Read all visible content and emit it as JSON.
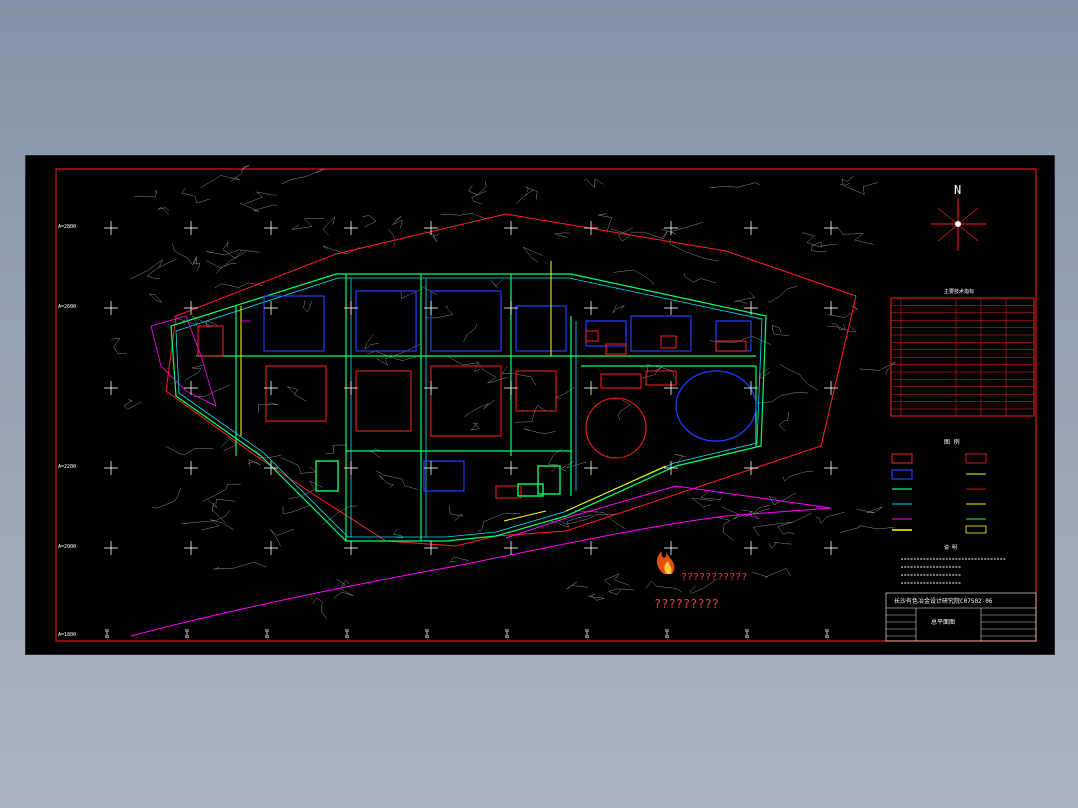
{
  "drawing": {
    "north_label": "N",
    "watermark_line1": "???????????",
    "watermark_line2": "?????????",
    "title_block_heading": "长沙有色冶金设计研究院C07502-06",
    "title_block_name": "总平面图",
    "legend_title": "图 例",
    "notes_title": "说 明",
    "table_title": "主要技术指标"
  },
  "colors": {
    "background": "#000000",
    "border": "#ff2020",
    "terrain": "#c8c8c8",
    "road": "#00ff66",
    "building_blue": "#2040ff",
    "building_red": "#ff2020",
    "boundary_magenta": "#ff00ff",
    "cyan": "#00e0ff",
    "yellow": "#ffff00"
  }
}
